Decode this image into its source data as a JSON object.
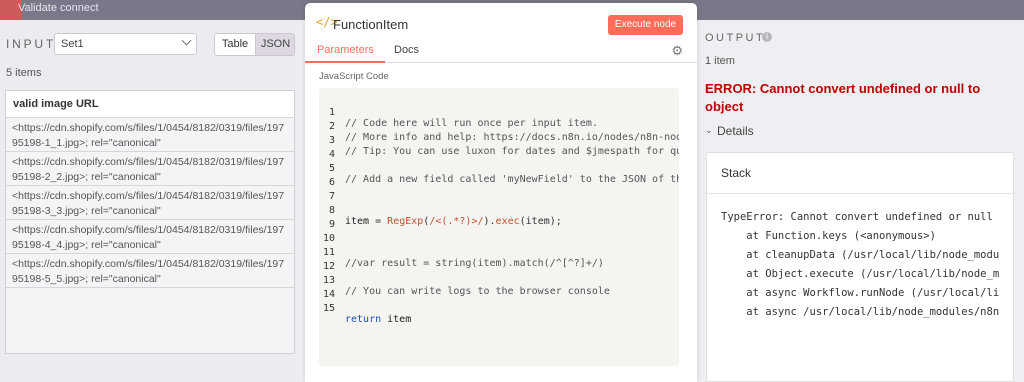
{
  "topbar": {
    "partial_label": "Validate connect"
  },
  "input_panel": {
    "title": "INPUT",
    "select_value": "Set1",
    "view_options": [
      "Table",
      "JSON"
    ],
    "items_count": "5 items",
    "column_header": "valid image URL",
    "rows": [
      [
        "<https://cdn.shopify.com/s/files/1/0454/8182/0319/files/197",
        "95198-1_1.jpg>; rel=\"canonical\""
      ],
      [
        "<https://cdn.shopify.com/s/files/1/0454/8182/0319/files/197",
        "95198-2_2.jpg>; rel=\"canonical\""
      ],
      [
        "<https://cdn.shopify.com/s/files/1/0454/8182/0319/files/197",
        "95198-3_3.jpg>; rel=\"canonical\""
      ],
      [
        "<https://cdn.shopify.com/s/files/1/0454/8182/0319/files/197",
        "95198-4_4.jpg>; rel=\"canonical\""
      ],
      [
        "<https://cdn.shopify.com/s/files/1/0454/8182/0319/files/197",
        "95198-5_5.jpg>; rel=\"canonical\""
      ]
    ]
  },
  "node_panel": {
    "icon": "</>",
    "title": "FunctionItem",
    "execute_label": "Execute node",
    "tabs": [
      "Parameters",
      "Docs"
    ],
    "settings_icon": "gear-icon",
    "section_label": "JavaScript Code",
    "code_lines": [
      {
        "n": "1",
        "text": "// Code here will run once per input item."
      },
      {
        "n": "2",
        "text": "// More info and help: https://docs.n8n.io/nodes/n8n-nodes-ba"
      },
      {
        "n": "3",
        "text": "// Tip: You can use luxon for dates and $jmespath for queryin"
      },
      {
        "n": "4",
        "text": ""
      },
      {
        "n": "5",
        "text": "// Add a new field called 'myNewField' to the JSON of the ite"
      },
      {
        "n": "6",
        "text": ""
      },
      {
        "n": "7",
        "text": ""
      },
      {
        "n": "8",
        "text": "item = RegExp(/<(.*?)>/).exec(item);"
      },
      {
        "n": "9",
        "text": ""
      },
      {
        "n": "10",
        "text": ""
      },
      {
        "n": "11",
        "text": "//var result = string(item).match(/^[^?]+/)"
      },
      {
        "n": "12",
        "text": ""
      },
      {
        "n": "13",
        "text": "// You can write logs to the browser console"
      },
      {
        "n": "14",
        "text": ""
      },
      {
        "n": "15",
        "text": "return item"
      }
    ],
    "code8": {
      "a": "item",
      "b": " = ",
      "fn": "RegExp",
      "c": "(",
      "re": "/<(.*?)>/",
      "d": ").",
      "fn2": "exec",
      "e": "(item);"
    },
    "code15": {
      "kw": "return",
      "rest": " item"
    }
  },
  "output_panel": {
    "title": "OUTPUT",
    "info_icon": "i",
    "count": "1 item",
    "error": "ERROR: Cannot convert undefined or null to object",
    "details_label": "Details",
    "stack_label": "Stack",
    "stack_lines": [
      "TypeError: Cannot convert undefined or null",
      "    at Function.keys (<anonymous>)",
      "    at cleanupData (/usr/local/lib/node_modu",
      "    at Object.execute (/usr/local/lib/node_m",
      "    at async Workflow.runNode (/usr/local/li",
      "    at async /usr/local/lib/node_modules/n8n"
    ]
  },
  "colors": {
    "accent": "#ff6d5a",
    "error": "#c00000"
  }
}
